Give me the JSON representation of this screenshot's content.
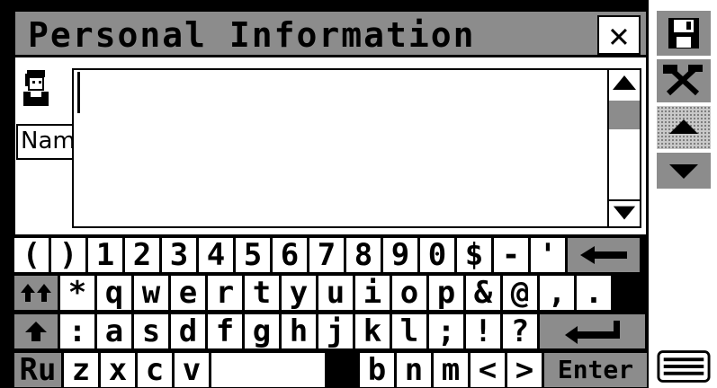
{
  "window": {
    "title": "Personal Information"
  },
  "field": {
    "label": "Name",
    "value": ""
  },
  "keyboard": {
    "row1": [
      "(",
      ")",
      "1",
      "2",
      "3",
      "4",
      "5",
      "6",
      "7",
      "8",
      "9",
      "0",
      "$",
      "-",
      "'"
    ],
    "row2": [
      "*",
      "q",
      "w",
      "e",
      "r",
      "t",
      "y",
      "u",
      "i",
      "o",
      "p",
      "&",
      "@",
      ",",
      "."
    ],
    "row3": [
      ":",
      "a",
      "s",
      "d",
      "f",
      "g",
      "h",
      "j",
      "k",
      "l",
      ";",
      "!",
      "?"
    ],
    "row4_left": [
      "Ru",
      "z",
      "x",
      "c",
      "v"
    ],
    "row4_right": [
      "b",
      "n",
      "m",
      "<",
      ">"
    ],
    "enter_label": "Enter"
  },
  "icons": {
    "close": "close-icon",
    "save": "floppy-disk-icon",
    "tools": "tools-icon",
    "up": "arrow-up-icon",
    "down": "arrow-down-icon",
    "keyboard": "keyboard-icon",
    "backspace": "backspace-arrow-icon",
    "shift": "shift-icon",
    "caps": "caps-lock-icon",
    "return": "return-icon",
    "user": "user-avatar-icon"
  },
  "colors": {
    "panel_gray": "#8c8c8c",
    "background": "#ffffff",
    "ink": "#000000"
  }
}
